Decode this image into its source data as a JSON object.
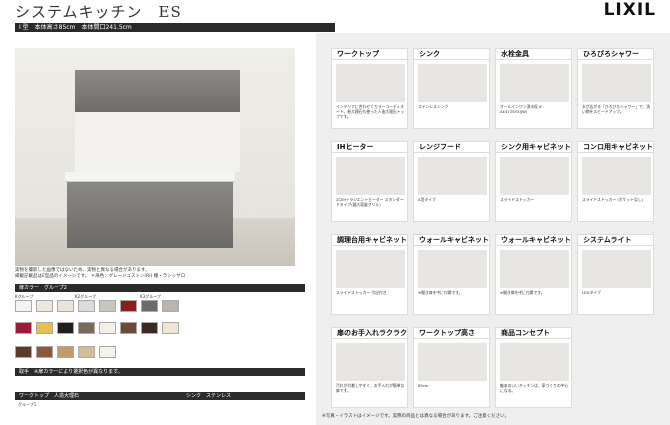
{
  "header": {
    "title": "システムキッチン　ES",
    "logo": "LIXIL",
    "subbar": "I 型　本体高さ85cm　本体間口241.5cm"
  },
  "left": {
    "note1": "実物を撮影した画像ではないため、実物と異なる場合があります。",
    "note2": "掲載記載品はE型品のイメージです。 ＊扉色：グレージュストン(RI) 棚・ラシッサロ",
    "color_section": "扉カラー　グループ2",
    "group_labels": [
      "Kグループ",
      "K2グループ",
      "K3グループ"
    ],
    "work_section": "取手　※扉カラーにより選択色が異なります。",
    "worktop_section": "ワークトップ　人造大理石",
    "worktop_group": "グループ1",
    "sink_section": "シンク　ステンレス"
  },
  "colors": {
    "row1": [
      "#f2f2f2",
      "#ece8df",
      "#e8e4db",
      "#dcdcdc",
      "#c8c6c1",
      "#8c1d1d",
      "#6b6b6b",
      "#b9b4ad"
    ],
    "row2": [
      "#a0183c",
      "#e7c04c",
      "#1f1f1f",
      "#7a6a5a",
      "#f4f0e7",
      "#6d4a33",
      "#3b2a24",
      "#efe6d6"
    ],
    "row3": [
      "#5a3a2a",
      "#8a5a3a",
      "#c49a6c",
      "#d7bc98",
      "#f6f3ed"
    ]
  },
  "cards": [
    {
      "title": "ワークトップ",
      "text": "インテリアに合わせてカラーコーディネート。新大理石も使った人造大理石トップです。"
    },
    {
      "title": "シンク",
      "text": "ステンレスシンク"
    },
    {
      "title": "水栓金具",
      "text": "オールインワン浄水栓 JF-AE472SYX(JW)"
    },
    {
      "title": "ひろびろシャワー",
      "text": "水が広がる「ひろびろシャワー」で、洗い物をスピードアップ。"
    },
    {
      "title": "IHヒーター",
      "text": "2口IH+ラジエントヒーター スタンダードタイプ(鍋大容量グリル)"
    },
    {
      "title": "レンジフード",
      "text": "A型タイプ"
    },
    {
      "title": "シンク用キャビネット",
      "text": "スライドストッカー"
    },
    {
      "title": "コンロ用キャビネット",
      "text": "スライドストッカー (ポケットなし)"
    },
    {
      "title": "調理台用キャビネット",
      "text": "スライドストッカー 引出付き"
    },
    {
      "title": "ウォールキャビネット",
      "text": "※開き扉を中に付属です。"
    },
    {
      "title": "ウォールキャビネット",
      "text": "※開き扉を中に付属です。"
    },
    {
      "title": "システムライト",
      "text": "LEDタイプ"
    },
    {
      "title": "扉のお手入れラクラク",
      "text": "汚れが付着しやすく、お手入れが簡単な扉です。"
    },
    {
      "title": "ワークトップ高さ",
      "text": "85cm"
    },
    {
      "title": "商品コンセプト",
      "text": "魅あのいいキッチンは、家づくりの中心になる。"
    }
  ],
  "footer": "※写真・イラストはイメージです。実際の商品とは異なる場合があります。ご注意ください。"
}
